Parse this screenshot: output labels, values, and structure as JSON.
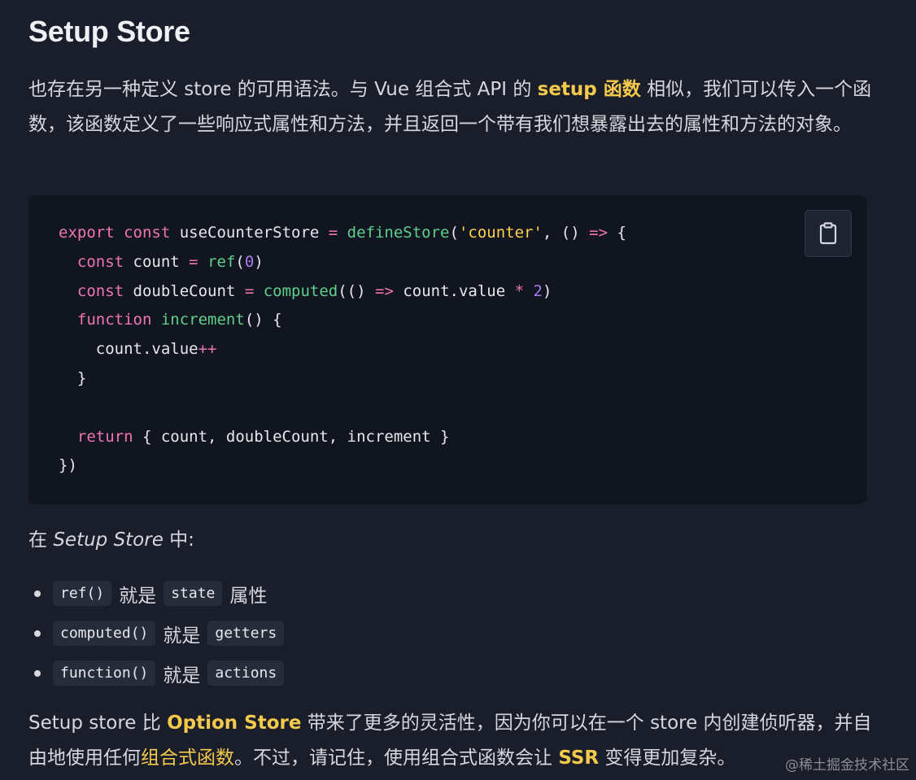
{
  "heading": "Setup Store",
  "intro": {
    "part1": "也存在另一种定义 store 的可用语法。与 Vue 组合式 API 的 ",
    "link": "setup 函数",
    "part2": " 相似，我们可以传入一个函数，该函数定义了一些响应式属性和方法，并且返回一个带有我们想暴露出去的属性和方法的对象。"
  },
  "code": {
    "copy_icon": "clipboard-icon",
    "lines": [
      "export const useCounterStore = defineStore('counter', () => {",
      "  const count = ref(0)",
      "  const doubleCount = computed(() => count.value * 2)",
      "  function increment() {",
      "    count.value++",
      "  }",
      "",
      "  return { count, doubleCount, increment }",
      "})"
    ]
  },
  "section": {
    "prefix": "在 ",
    "term": "Setup Store",
    "suffix": " 中:"
  },
  "bullets": [
    {
      "code": "ref()",
      "text": "就是",
      "target": "state",
      "tail": "属性"
    },
    {
      "code": "computed()",
      "text": "就是",
      "target": "getters",
      "tail": ""
    },
    {
      "code": "function()",
      "text": "就是",
      "target": "actions",
      "tail": ""
    }
  ],
  "outro": {
    "part1": "Setup store 比 ",
    "link1": "Option Store",
    "part2": " 带来了更多的灵活性，因为你可以在一个 store 内创建侦听器，并自由地使用任何",
    "link2": "组合式函数",
    "part3": "。不过，请记住，使用组合式函数会让 ",
    "link3": "SSR",
    "part4": " 变得更加复杂。"
  },
  "watermark": "@稀土掘金技术社区",
  "colors": {
    "background": "#1a1d2a",
    "code_background": "#111520",
    "accent_link": "#f4c94c",
    "keyword": "#f075b4",
    "function": "#5ed08b",
    "string": "#ffd24d",
    "number": "#a97bf0"
  }
}
